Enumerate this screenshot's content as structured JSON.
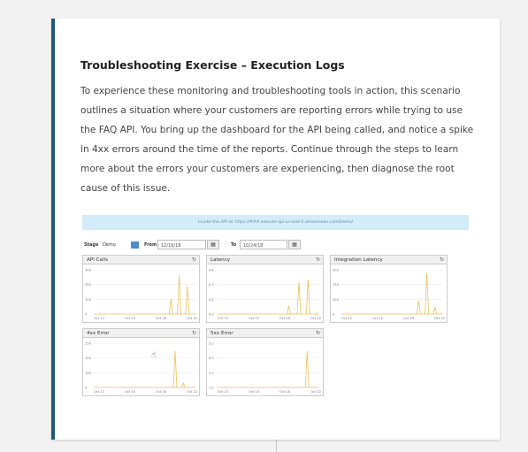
{
  "exercise": {
    "title": "Troubleshooting Exercise – Execution Logs",
    "body": "To experience these monitoring and troubleshooting tools in action, this scenario outlines a situation where your customers are reporting errors while trying to use the FAQ API. You bring up the dashboard for the API being called, and notice a spike in 4xx errors around the time of the reports. Continue through the steps to learn more about the errors your customers are experiencing, then diagnose the root cause of this issue."
  },
  "dashboard": {
    "invoke_text": "Invoke this API at: https://###.execute-api.us-east-2.amazonaws.com/Demo/",
    "stage_label": "Stage",
    "stage_value": "Demo",
    "from_label": "From",
    "from_value": "12/16/18",
    "to_label": "To",
    "to_value": "10/24/18",
    "line_color": "#e8c25a",
    "panels": [
      {
        "title": "API Calls",
        "ticks": [
          "300",
          "200",
          "100",
          "0"
        ],
        "xticks": [
          "Oct 13",
          "Oct 15",
          "Oct 18",
          "Oct 20"
        ],
        "spikes": [
          [
            0.76,
            0.35
          ],
          [
            0.84,
            0.88
          ],
          [
            0.92,
            0.62
          ]
        ]
      },
      {
        "title": "Latency",
        "ticks": [
          "0.4",
          "0.3",
          "0.2",
          "0.0"
        ],
        "xticks": [
          "Oct 13",
          "Oct 15",
          "Oct 18",
          "Oct 20"
        ],
        "spikes": [
          [
            0.7,
            0.18
          ],
          [
            0.8,
            0.72
          ],
          [
            0.89,
            0.78
          ]
        ]
      },
      {
        "title": "Integration Latency",
        "ticks": [
          "200",
          "150",
          "100",
          "0"
        ],
        "xticks": [
          "Oct 13",
          "Oct 15",
          "Oct 18",
          "Oct 20"
        ],
        "spikes": [
          [
            0.76,
            0.3
          ],
          [
            0.84,
            0.92
          ],
          [
            0.92,
            0.15
          ]
        ]
      },
      {
        "title": "4xx Error",
        "ticks": [
          "250",
          "150",
          "100",
          "0"
        ],
        "xticks": [
          "Oct 13",
          "Oct 15",
          "Oct 18",
          "Oct 22"
        ],
        "spikes": [
          [
            0.8,
            0.82
          ],
          [
            0.88,
            0.1
          ]
        ]
      },
      {
        "title": "5xx Error",
        "ticks": [
          "5.0",
          "4.0",
          "2.0",
          "1.0"
        ],
        "xticks": [
          "Oct 13",
          "Oct 15",
          "Oct 18",
          "Oct 22"
        ],
        "spikes": [
          [
            0.88,
            0.82
          ]
        ]
      }
    ]
  }
}
